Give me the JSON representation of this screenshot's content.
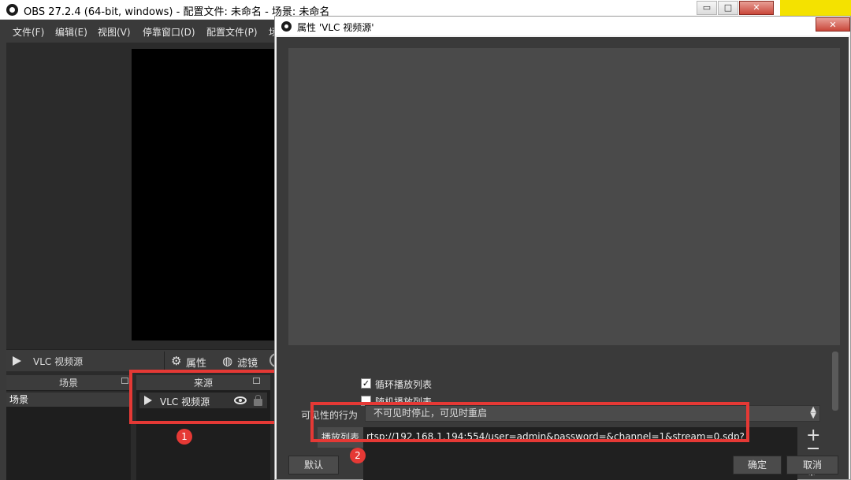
{
  "main_window": {
    "title": "OBS 27.2.4 (64-bit, windows) - 配置文件: 未命名 - 场景: 未命名",
    "controls": {
      "minimize": "▭",
      "maximize": "□",
      "close": "✕"
    }
  },
  "menu": {
    "items": [
      "文件(F)",
      "编辑(E)",
      "视图(V)",
      "停靠窗口(D)",
      "配置文件(P)",
      "场"
    ]
  },
  "source_toolbar": {
    "source_name": "VLC 视频源",
    "properties_label": "属性",
    "filters_label": "滤镜"
  },
  "scenes_dock": {
    "title": "场景",
    "items": [
      "场景"
    ]
  },
  "sources_dock": {
    "title": "来源",
    "items": [
      {
        "label": "VLC 视频源"
      }
    ]
  },
  "dialog": {
    "title": "属性 'VLC 视频源'",
    "close": "✕",
    "loop_playlist_label": "循环播放列表",
    "loop_playlist_checked": "✓",
    "shuffle_playlist_label": "随机播放列表",
    "visibility_label": "可见性的行为",
    "visibility_value": "不可见时停止，可见时重启",
    "playlist_label": "播放列表",
    "playlist_entries": [
      "rtsp://192.168.1.194:554/user=admin&password=&channel=1&stream=0.sdp?"
    ],
    "add_button": "+",
    "gear_button": "⚙",
    "default_button": "默认",
    "ok_button": "确定",
    "cancel_button": "取消"
  },
  "annotations": {
    "badge_1": "1",
    "badge_2": "2"
  },
  "colors": {
    "highlight_red": "#e53935",
    "panel_dark": "#2b2b2b",
    "dialog_bg": "#3a3a3a"
  }
}
